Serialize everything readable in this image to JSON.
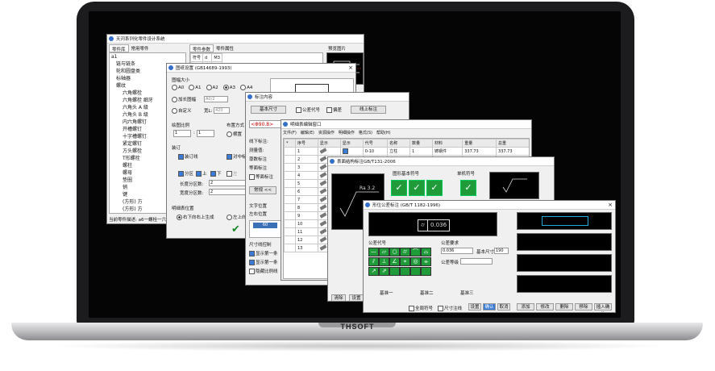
{
  "device": {
    "brand": "THSOFT"
  },
  "main_window": {
    "title": "天河系列化零件设计系统",
    "tabs": [
      "零件库",
      "常用零件"
    ],
    "tree": [
      "a1",
      "链与链条",
      "轮和圆盘类",
      "标轴器",
      "螺纹",
      "六角螺栓",
      "六角螺栓 细牙",
      "六角头 A 级",
      "六角头 B 级",
      "内六角螺钉",
      "开槽螺钉",
      "十字槽螺钉",
      "紧定螺钉",
      "方头螺栓",
      "T形螺栓",
      "螺柱",
      "螺母",
      "垫圈",
      "销",
      "键",
      "(方形) 方",
      "(方形) 方",
      "四大类螺钉",
      "定位-定位螺钉",
      "木螺钉",
      "十字槽螺钉",
      "自攻螺钉"
    ],
    "detail_tabs": [
      "零件参数",
      "零件属性"
    ],
    "detail_header": [
      "符号",
      "d",
      "M3"
    ],
    "detail_rows": [
      [
        "M",
        "24",
        "9"
      ],
      [
        "b",
        "34",
        "6"
      ],
      [
        "k",
        "36",
        "13"
      ],
      [
        "s",
        "",
        "24"
      ],
      [
        "e",
        "",
        "6.2"
      ],
      [
        "l",
        "",
        "8"
      ],
      [
        "",
        "",
        ""
      ],
      [
        "",
        "",
        ""
      ]
    ],
    "preview_label": "预览图片",
    "status": "当前零件描述: a6一螺栓一六角"
  },
  "frame_dialog": {
    "title": "图纸设置 (GB14689-1993)",
    "size_label": "图幅大小",
    "sizes": [
      "A0",
      "A1",
      "A2",
      "A3",
      "A4"
    ],
    "opt1": "加长图幅",
    "opt1_value": "A0/2",
    "opt2": "自定义",
    "width_label": "宽L:",
    "width_value": "420",
    "scale_label": "绘图比例",
    "scale_values": [
      "1",
      "1"
    ],
    "place_label": "布置方式",
    "place_opts": [
      "横置",
      "竖置"
    ],
    "mount_label": "装订",
    "mount_check": "装订线",
    "center_check": "对中标志",
    "div_label": "分区",
    "div_top": "上",
    "div_bottom": "下",
    "div_left": "左",
    "div_h": "长度分区数:",
    "div_h_value": "2",
    "div_w": "宽度分区数:",
    "div_w_value": "2",
    "list_label": "明细表位置",
    "list_opt1": "右下向右上生成",
    "list_opt2": "左上向"
  },
  "annot_dialog": {
    "title": "标注内容",
    "tab": "基本尺寸",
    "chk1": "公差代号",
    "chk2": "偏差",
    "btn": "线上标注",
    "value": "<Φ90.8>",
    "line_lbl": "线下标注:",
    "fields": [
      "测量值:",
      "尊数标注",
      "等面标注"
    ],
    "frac_check": "等面标注",
    "expand_btn": "常规 <<",
    "text_pos": "文字位置",
    "align": "左右位置",
    "gauge_val": "60",
    "dim_ctrl": "尺寸线控制",
    "dim_opts": [
      "显示第一条",
      "显示第一条",
      "隐藏比例线"
    ]
  },
  "list_dialog": {
    "title": "明细表编辑窗口",
    "menu": [
      "文件(F)",
      "编辑(E)",
      "资源操作",
      "明细操作",
      "格式(S)",
      "帮助(H)"
    ],
    "headers": [
      "*",
      "序号",
      "显示",
      "显示",
      "代号",
      "名称",
      "数量",
      "材料",
      "重量",
      "总重"
    ],
    "rows": [
      {
        "no": "1",
        "code": "0-10",
        "name": "立柱",
        "qty": "1",
        "mat": "铸钢件",
        "w": "337.73",
        "tw": "337.73"
      },
      {
        "no": "2",
        "code": "",
        "name": "",
        "qty": "",
        "mat": "",
        "w": "",
        "tw": ""
      },
      {
        "no": "3",
        "code": "",
        "name": "",
        "qty": "",
        "mat": "",
        "w": "",
        "tw": ""
      },
      {
        "no": "4",
        "code": "",
        "name": "",
        "qty": "",
        "mat": "",
        "w": "",
        "tw": ""
      },
      {
        "no": "5",
        "code": "",
        "name": "",
        "qty": "",
        "mat": "",
        "w": "",
        "tw": ""
      },
      {
        "no": "6",
        "code": "",
        "name": "",
        "qty": "",
        "mat": "",
        "w": "",
        "tw": ""
      },
      {
        "no": "7",
        "code": "",
        "name": "",
        "qty": "",
        "mat": "",
        "w": "",
        "tw": ""
      },
      {
        "no": "8",
        "code": "",
        "name": "",
        "qty": "",
        "mat": "",
        "w": "",
        "tw": ""
      },
      {
        "no": "9",
        "code": "",
        "name": "",
        "qty": "",
        "mat": "",
        "w": "",
        "tw": ""
      },
      {
        "no": "10",
        "code": "",
        "name": "",
        "qty": "",
        "mat": "",
        "w": "",
        "tw": ""
      },
      {
        "no": "11",
        "code": "",
        "name": "",
        "qty": "",
        "mat": "",
        "w": "",
        "tw": ""
      },
      {
        "no": "12",
        "code": "",
        "name": "",
        "qty": "",
        "mat": "",
        "w": "",
        "tw": ""
      },
      {
        "no": "13",
        "code": "",
        "name": "",
        "qty": "",
        "mat": "",
        "w": "",
        "tw": ""
      }
    ]
  },
  "rough_dialog": {
    "title": "表面结构标注GB/T131-2006",
    "basic_label": "图形基本符号",
    "extra_label": "单机符号",
    "preview_text": "Ra 3.2",
    "clear_btn": "清除",
    "set_btn": "设置"
  },
  "tol_dialog": {
    "title": "形位公差标注 (GB/T 1182-1996)",
    "code_label": "公差代号",
    "req_label": "公差要求",
    "preview": "0.036",
    "tol_value": "0.036",
    "basic_label": "基本尺寸",
    "basic_value": "190",
    "coef_label": "公差等级",
    "coef_value": "",
    "sym_label": "公差代号",
    "ref_labels": [
      "基准一",
      "基准二",
      "基准三"
    ],
    "check1": "全周符号",
    "check2": "尺寸注线",
    "buttons": [
      "设置",
      "确认",
      "取消"
    ],
    "right_buttons": [
      "添加",
      "修改",
      "删除",
      "移除",
      "插入确认"
    ],
    "sym_cells": [
      "—",
      "▱",
      "○",
      "⌭",
      "⌒",
      "⌓",
      "⫽",
      "⊥",
      "∠",
      "⌖",
      "◎",
      "⌯",
      "↗",
      "⇗",
      "",
      "",
      "",
      ""
    ]
  }
}
